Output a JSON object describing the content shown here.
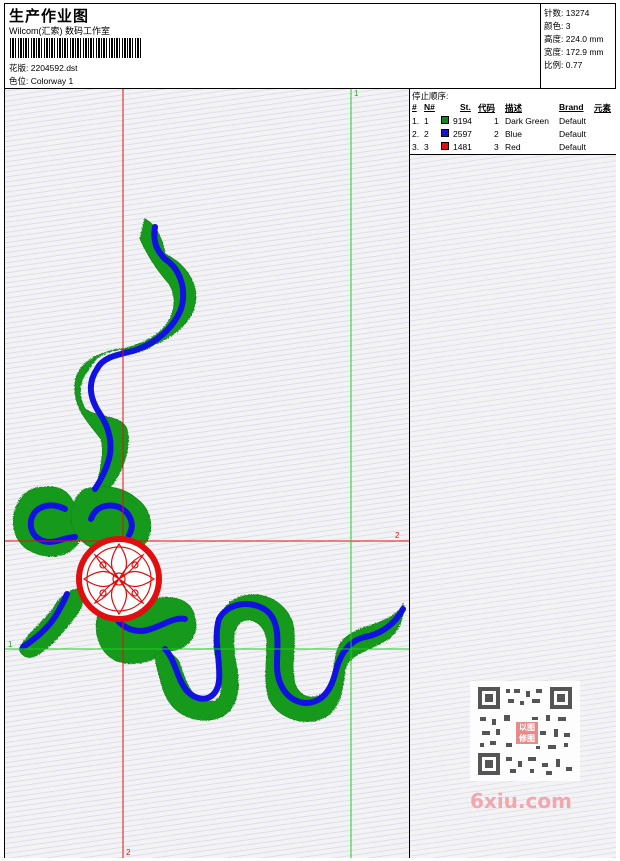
{
  "header": {
    "title": "生产作业图",
    "subtitle": "Wilcom(汇索) 数码工作室",
    "design_label": "花版:",
    "design_value": "2204592.dst",
    "colorway_label": "色位:",
    "colorway_value": "Colorway 1"
  },
  "stats": {
    "stitches_label": "针数:",
    "stitches_value": "13274",
    "colors_label": "颜色:",
    "colors_value": "3",
    "height_label": "高度:",
    "height_value": "224.0 mm",
    "width_label": "宽度:",
    "width_value": "172.9 mm",
    "scale_label": "比例:",
    "scale_value": "0.77"
  },
  "guides": {
    "green_top_label": "1",
    "green_left_label": "1",
    "red_right_label": "2",
    "red_bottom_label": "2"
  },
  "stop_sequence": {
    "label": "停止顺序:",
    "columns": [
      "#",
      "N#",
      "St.",
      "代码",
      "描述",
      "Brand",
      "元素"
    ],
    "rows": [
      {
        "num": "1.",
        "n": "1",
        "color": "#0a8a1a",
        "stitches": "9194",
        "code": "1",
        "desc": "Dark Green",
        "brand": "Default"
      },
      {
        "num": "2.",
        "n": "2",
        "color": "#1414d8",
        "stitches": "2597",
        "code": "2",
        "desc": "Blue",
        "brand": "Default"
      },
      {
        "num": "3.",
        "n": "3",
        "color": "#e01010",
        "stitches": "1481",
        "code": "3",
        "desc": "Red",
        "brand": "Default"
      }
    ]
  },
  "watermark": {
    "text": "6xiu.com",
    "badge_line1": "以图",
    "badge_line2": "修图"
  },
  "colors": {
    "green": "#199a1e",
    "blue": "#1212e0",
    "red": "#e00e0e",
    "guide_green": "#22cc22",
    "guide_red": "#e01010"
  }
}
